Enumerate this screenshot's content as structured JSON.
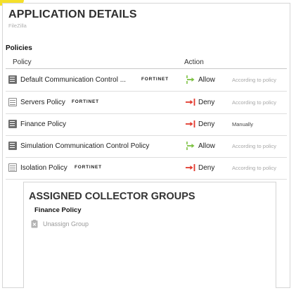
{
  "app": {
    "title": "APPLICATION DETAILS",
    "subtitle": "FileZilla"
  },
  "policies": {
    "section_label": "Policies",
    "columns": {
      "policy": "Policy",
      "action": "Action"
    },
    "rows": [
      {
        "name": "Default Communication Control ...",
        "vendor": "FORTINET",
        "action": "Allow",
        "mode": "According to policy",
        "icon": "policy-doc-filled-icon",
        "action_icon": "allow-arrow-icon"
      },
      {
        "name": "Servers Policy",
        "vendor": "FORTINET",
        "action": "Deny",
        "mode": "According to policy",
        "icon": "policy-doc-outline-icon",
        "action_icon": "deny-arrow-icon"
      },
      {
        "name": "Finance Policy",
        "vendor": "",
        "action": "Deny",
        "mode": "Manually",
        "icon": "policy-doc-filled-icon",
        "action_icon": "deny-arrow-icon"
      },
      {
        "name": "Simulation Communication Control Policy",
        "vendor": "",
        "action": "Allow",
        "mode": "According to policy",
        "icon": "policy-doc-filled-icon",
        "action_icon": "allow-arrow-icon"
      },
      {
        "name": "Isolation Policy",
        "vendor": "FORTINET",
        "action": "Deny",
        "mode": "According to policy",
        "icon": "policy-doc-outline-icon",
        "action_icon": "deny-arrow-icon"
      }
    ]
  },
  "collector_groups": {
    "title": "ASSIGNED COLLECTOR GROUPS",
    "policy_name": "Finance Policy",
    "unassign_label": "Unassign Group"
  },
  "colors": {
    "allow_green": "#7cc142",
    "deny_red": "#e23a2e",
    "corner_yellow": "#f5e02a"
  }
}
